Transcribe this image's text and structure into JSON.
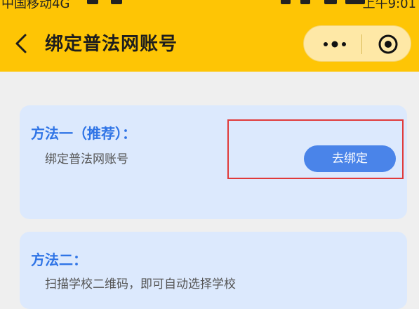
{
  "status_bar": {
    "carrier": "中国移动4G",
    "time": "上午9:01"
  },
  "header": {
    "title": "绑定普法网账号",
    "back_icon": "chevron-left-icon",
    "more_icon": "more-dots-icon",
    "close_icon": "target-circle-icon"
  },
  "method1": {
    "title": "方法一（推荐）：",
    "description": "绑定普法网账号",
    "button_label": "去绑定"
  },
  "method2": {
    "title": "方法二：",
    "description": "扫描学校二维码，即可自动选择学校"
  },
  "colors": {
    "header_bg": "#fec505",
    "card_bg": "#dce9fd",
    "accent_blue": "#2f74e6",
    "button_blue": "#4a84e9",
    "highlight_red": "#e03a3a"
  }
}
